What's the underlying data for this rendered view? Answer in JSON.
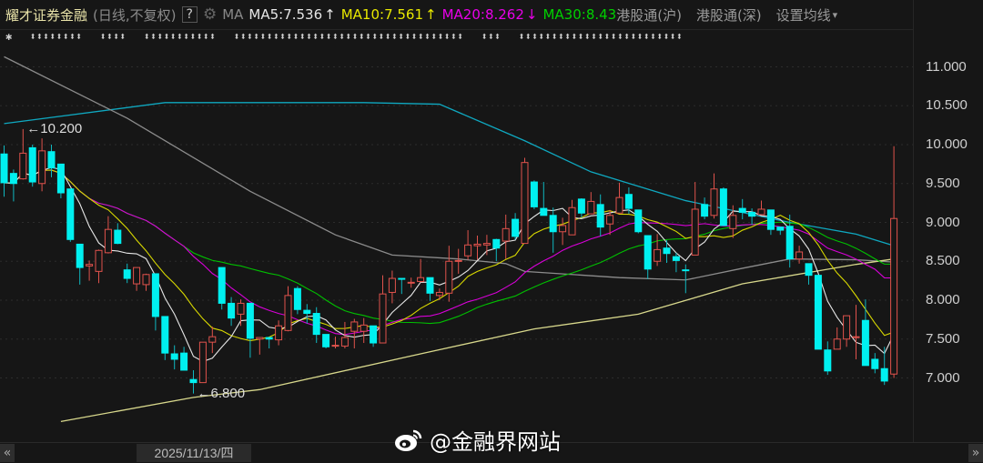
{
  "header": {
    "title": "耀才证券金融",
    "period": "(日线,不复权)",
    "help": "?",
    "gear_icon": "gear-icon",
    "ma_label": "MA",
    "ma5": "MA5:7.536",
    "ma5_dir": "↑",
    "ma10": "MA10:7.561",
    "ma10_dir": "↑",
    "ma20": "MA20:8.262",
    "ma20_dir": "↓",
    "ma30": "MA30:8.43",
    "hk_sh": "港股通(沪)",
    "hk_sz": "港股通(深)",
    "set_ma": "设置均线",
    "set_ma_caret": "▾"
  },
  "row2": {
    "star": "✱",
    "g1": "⬍⬍⬍⬍⬍⬍⬍⬍",
    "g2": "⬍⬍⬍⬍",
    "g3": "⬍⬍⬍⬍⬍⬍⬍⬍⬍⬍⬍",
    "g4": "⬍⬍⬍⬍⬍⬍⬍⬍⬍⬍⬍⬍⬍⬍⬍⬍⬍⬍⬍⬍⬍⬍⬍⬍⬍⬍⬍⬍⬍⬍⬍⬍⬍⬍⬍",
    "g5": "⬍⬍⬍",
    "g6": "⬍⬍⬍⬍⬍⬍⬍⬍⬍⬍⬍⬍⬍⬍⬍⬍⬍⬍⬍⬍⬍⬍⬍⬍⬍"
  },
  "footer": {
    "date": "2025/11/13/四",
    "left_arrow": "«",
    "right_arrow": "»",
    "watermark": "@金融界网站"
  },
  "colors": {
    "up": "#e0524c",
    "down": "#00f0f0",
    "bg": "#161616",
    "ma5": "#e6e6e6",
    "ma10": "#d8d800",
    "ma20": "#d800d8",
    "ma30": "#00c000",
    "ma_cyan": "#0fa8c0",
    "ma_gray": "#8c8c8c",
    "ma_long": "#d8d88c"
  },
  "chart_data": {
    "type": "candlestick",
    "title": "耀才证券金融 (日线,不复权)",
    "ylim": [
      6.2,
      11.2
    ],
    "yticks": [
      "11.000",
      "10.500",
      "10.000",
      "9.500",
      "9.000",
      "8.500",
      "8.000",
      "7.500",
      "7.000"
    ],
    "ytick_values": [
      11,
      10.5,
      10,
      9.5,
      9,
      8.5,
      8,
      7.5,
      7
    ],
    "annotations": [
      {
        "label": "10.200",
        "value": 10.2,
        "index": 2
      },
      {
        "label": "6.800",
        "value": 6.8,
        "index": 20
      }
    ],
    "ohlc": [
      [
        9.88,
        9.99,
        9.33,
        9.51
      ],
      [
        9.63,
        9.68,
        9.27,
        9.5
      ],
      [
        9.56,
        10.2,
        9.55,
        9.89
      ],
      [
        9.96,
        10.0,
        9.46,
        9.52
      ],
      [
        9.5,
        10.08,
        9.4,
        9.92
      ],
      [
        9.91,
        10.0,
        9.58,
        9.7
      ],
      [
        9.75,
        9.75,
        9.31,
        9.38
      ],
      [
        9.43,
        9.43,
        8.75,
        8.78
      ],
      [
        8.72,
        8.72,
        8.2,
        8.42
      ],
      [
        8.44,
        8.51,
        8.25,
        8.46
      ],
      [
        8.37,
        8.65,
        8.22,
        8.64
      ],
      [
        8.61,
        9.08,
        8.6,
        8.91
      ],
      [
        8.9,
        8.99,
        8.72,
        8.73
      ],
      [
        8.39,
        8.47,
        8.22,
        8.28
      ],
      [
        8.21,
        8.42,
        8.12,
        8.42
      ],
      [
        8.2,
        8.34,
        8.12,
        8.33
      ],
      [
        8.34,
        8.34,
        7.61,
        7.79
      ],
      [
        7.79,
        7.79,
        7.23,
        7.32
      ],
      [
        7.31,
        7.42,
        7.11,
        7.24
      ],
      [
        7.32,
        7.4,
        7.1,
        7.1
      ],
      [
        6.98,
        7.1,
        6.8,
        6.94
      ],
      [
        6.94,
        7.46,
        6.94,
        7.46
      ],
      [
        7.46,
        7.66,
        7.32,
        7.53
      ],
      [
        8.42,
        8.42,
        7.88,
        7.96
      ],
      [
        7.96,
        8.04,
        7.67,
        7.77
      ],
      [
        7.82,
        8.01,
        7.67,
        7.96
      ],
      [
        7.96,
        7.96,
        7.26,
        7.51
      ],
      [
        7.5,
        7.52,
        7.3,
        7.52
      ],
      [
        7.52,
        7.52,
        7.38,
        7.5
      ],
      [
        7.49,
        7.74,
        7.42,
        7.67
      ],
      [
        7.61,
        8.18,
        7.6,
        8.06
      ],
      [
        8.15,
        8.18,
        7.82,
        7.88
      ],
      [
        7.87,
        7.95,
        7.7,
        7.83
      ],
      [
        7.83,
        7.91,
        7.45,
        7.56
      ],
      [
        7.56,
        7.56,
        7.38,
        7.4
      ],
      [
        7.41,
        7.53,
        7.38,
        7.42
      ],
      [
        7.41,
        7.72,
        7.38,
        7.52
      ],
      [
        7.6,
        7.76,
        7.38,
        7.72
      ],
      [
        7.6,
        7.77,
        7.45,
        7.68
      ],
      [
        7.67,
        7.67,
        7.4,
        7.45
      ],
      [
        7.45,
        8.32,
        7.45,
        8.08
      ],
      [
        8.1,
        8.38,
        7.96,
        8.28
      ],
      [
        8.28,
        8.28,
        8.08,
        8.27
      ],
      [
        8.22,
        8.29,
        8.16,
        8.23
      ],
      [
        8.24,
        8.53,
        8.23,
        8.29
      ],
      [
        8.29,
        8.29,
        7.99,
        8.09
      ],
      [
        8.06,
        8.15,
        8.0,
        8.1
      ],
      [
        8.09,
        8.7,
        7.98,
        8.5
      ],
      [
        8.5,
        8.66,
        8.34,
        8.51
      ],
      [
        8.57,
        8.9,
        8.52,
        8.71
      ],
      [
        8.7,
        8.83,
        8.52,
        8.72
      ],
      [
        8.71,
        8.84,
        8.58,
        8.73
      ],
      [
        8.78,
        8.79,
        8.5,
        8.67
      ],
      [
        8.76,
        9.1,
        8.53,
        8.92
      ],
      [
        9.04,
        9.12,
        8.78,
        8.82
      ],
      [
        8.73,
        9.83,
        8.73,
        9.77
      ],
      [
        9.52,
        9.54,
        9.17,
        9.2
      ],
      [
        9.18,
        9.52,
        9.09,
        9.09
      ],
      [
        9.09,
        9.19,
        8.61,
        8.88
      ],
      [
        8.88,
        9.06,
        8.71,
        8.96
      ],
      [
        8.84,
        9.29,
        8.84,
        9.19
      ],
      [
        9.3,
        9.31,
        9.06,
        9.12
      ],
      [
        9.11,
        9.39,
        9.11,
        9.27
      ],
      [
        9.23,
        9.36,
        8.82,
        8.94
      ],
      [
        8.98,
        9.16,
        8.84,
        9.09
      ],
      [
        9.12,
        9.51,
        9.12,
        9.32
      ],
      [
        9.36,
        9.45,
        9.11,
        9.18
      ],
      [
        9.16,
        9.16,
        8.86,
        8.88
      ],
      [
        8.83,
        8.83,
        8.27,
        8.4
      ],
      [
        8.5,
        8.85,
        8.44,
        8.65
      ],
      [
        8.67,
        8.77,
        8.48,
        8.6
      ],
      [
        8.56,
        8.61,
        8.36,
        8.51
      ],
      [
        8.39,
        8.46,
        8.09,
        8.38
      ],
      [
        8.58,
        9.52,
        8.58,
        9.17
      ],
      [
        9.23,
        9.32,
        9.04,
        9.08
      ],
      [
        9.09,
        9.63,
        9.05,
        9.43
      ],
      [
        9.43,
        9.45,
        8.96,
        8.96
      ],
      [
        8.92,
        9.22,
        8.8,
        9.09
      ],
      [
        9.18,
        9.3,
        9.04,
        9.13
      ],
      [
        9.13,
        9.18,
        8.97,
        9.08
      ],
      [
        9.1,
        9.28,
        9.1,
        9.17
      ],
      [
        9.16,
        9.16,
        8.84,
        8.91
      ],
      [
        8.94,
        8.94,
        8.84,
        8.9
      ],
      [
        8.95,
        9.1,
        8.42,
        8.53
      ],
      [
        8.53,
        8.7,
        8.47,
        8.62
      ],
      [
        8.47,
        8.47,
        8.2,
        8.32
      ],
      [
        8.32,
        8.32,
        7.37,
        7.37
      ],
      [
        7.36,
        7.47,
        7.04,
        7.09
      ],
      [
        7.37,
        7.65,
        7.37,
        7.5
      ],
      [
        7.5,
        7.8,
        7.4,
        7.8
      ],
      [
        7.52,
        7.94,
        7.24,
        7.53
      ],
      [
        7.74,
        8.01,
        7.16,
        7.16
      ],
      [
        7.24,
        7.32,
        7.06,
        7.12
      ],
      [
        7.12,
        7.4,
        6.91,
        6.96
      ],
      [
        7.05,
        9.98,
        7.0,
        9.05
      ]
    ],
    "ohlc_fields": [
      "open",
      "high",
      "low",
      "close"
    ],
    "computed_ma_periods": [
      5,
      10,
      20,
      30
    ],
    "long_ma_series": [
      {
        "name": "cyan",
        "points": [
          [
            0,
            10.27
          ],
          [
            17,
            10.54
          ],
          [
            38,
            10.54
          ],
          [
            46,
            10.52
          ],
          [
            55,
            10.05
          ],
          [
            62,
            9.65
          ],
          [
            72,
            9.28
          ],
          [
            83,
            9.0
          ],
          [
            90,
            8.85
          ],
          [
            94,
            8.7
          ]
        ]
      },
      {
        "name": "gray",
        "points": [
          [
            0,
            11.13
          ],
          [
            13,
            10.34
          ],
          [
            26,
            9.4
          ],
          [
            35,
            8.84
          ],
          [
            41,
            8.58
          ],
          [
            48,
            8.53
          ],
          [
            53,
            8.47
          ],
          [
            55,
            8.37
          ],
          [
            65,
            8.29
          ],
          [
            72,
            8.26
          ],
          [
            78,
            8.41
          ],
          [
            83,
            8.53
          ],
          [
            90,
            8.52
          ],
          [
            94,
            8.49
          ]
        ]
      },
      {
        "name": "long",
        "points": [
          [
            6,
            6.44
          ],
          [
            20,
            6.75
          ],
          [
            27,
            6.85
          ],
          [
            44,
            7.31
          ],
          [
            56,
            7.63
          ],
          [
            67,
            7.82
          ],
          [
            78,
            8.21
          ],
          [
            90,
            8.46
          ],
          [
            94,
            8.53
          ]
        ]
      }
    ]
  }
}
